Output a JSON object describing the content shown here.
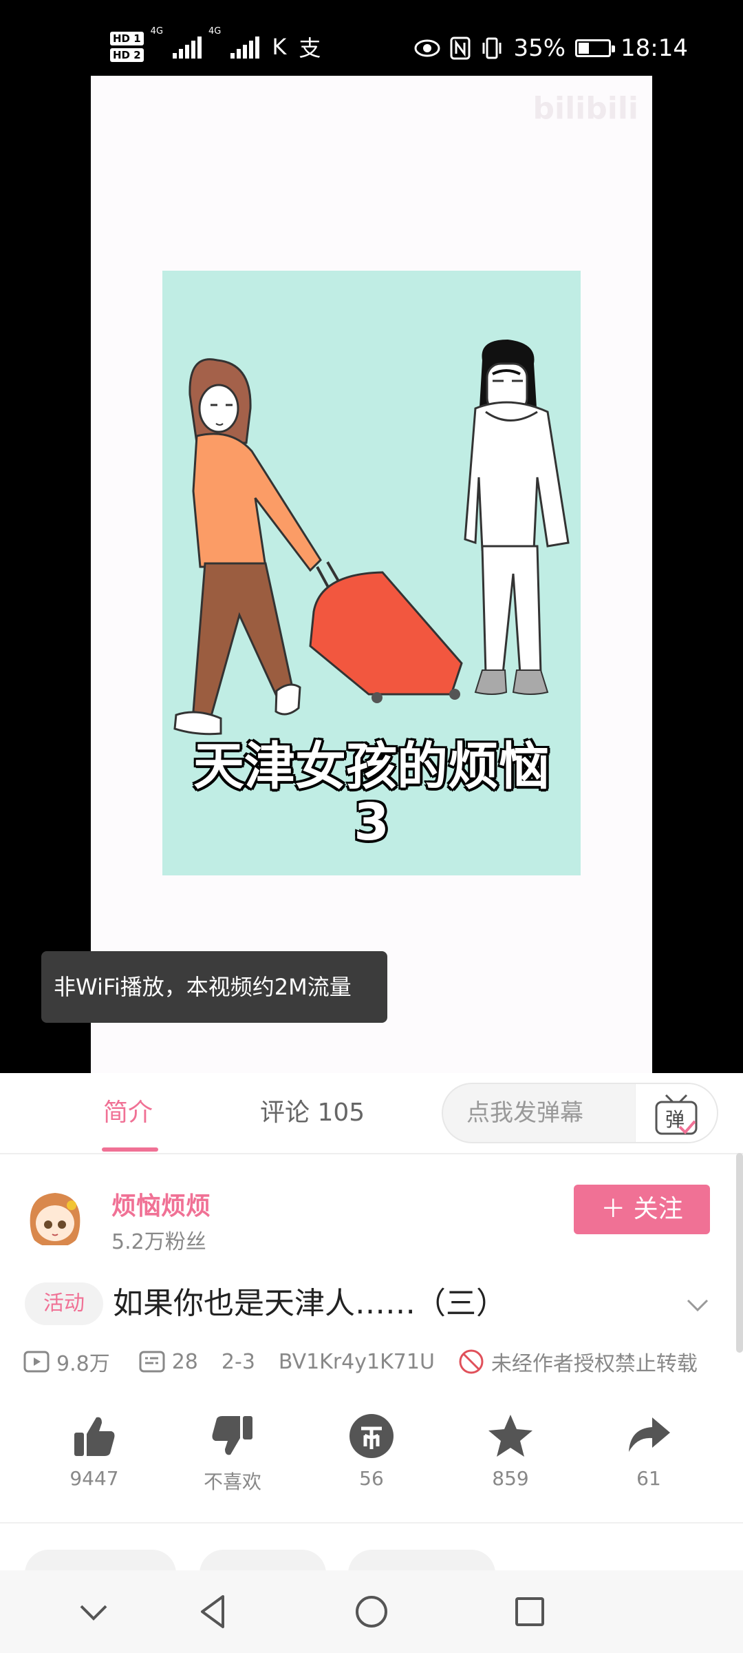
{
  "status_bar": {
    "hd1": "HD 1",
    "hd2": "HD 2",
    "network1": "4G",
    "network2": "4G",
    "battery_pct": "35%",
    "battery_level": 0.35,
    "time": "18:14"
  },
  "video": {
    "watermark": "bilibili",
    "title_line1": "天津女孩的烦恼",
    "title_line2": "3",
    "toast": "非WiFi播放，本视频约2M流量"
  },
  "tabs": {
    "intro": "简介",
    "comments": "评论 105"
  },
  "danmaku": {
    "placeholder": "点我发弹幕",
    "button_glyph": "弹"
  },
  "uploader": {
    "name": "烦恼烦烦",
    "fans": "5.2万粉丝",
    "follow_label": "＋ 关注"
  },
  "video_info": {
    "activity_badge": "活动",
    "title": "如果你也是天津人……（三）",
    "views": "9.8万",
    "danmaku_count": "28",
    "date": "2-3",
    "bvid": "BV1Kr4y1K71U",
    "copyright": "未经作者授权禁止转载"
  },
  "actions": {
    "like": "9447",
    "dislike": "不喜欢",
    "coin": "56",
    "favorite": "859",
    "share": "61"
  },
  "colors": {
    "accent": "#f07195",
    "thumb_bg": "#c0ede4"
  }
}
